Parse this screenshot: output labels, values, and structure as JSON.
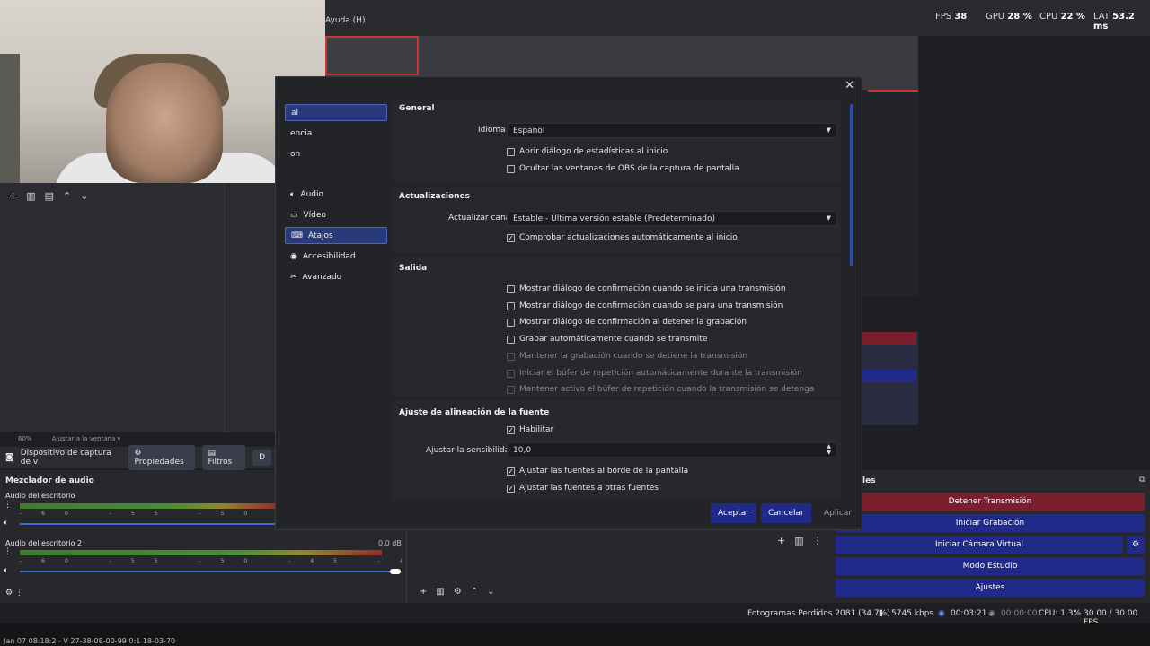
{
  "topbar": {
    "fps_label": "FPS",
    "fps": "38",
    "gpu_label": "GPU",
    "gpu": "28 %",
    "cpu_label": "CPU",
    "cpu": "22 %",
    "lat_label": "LAT",
    "lat": "53.2 ms"
  },
  "menu": {
    "help": "Ayuda (H)"
  },
  "preview": {
    "zoom": "60%",
    "fit": "Ajustar a la ventana"
  },
  "source_bar": {
    "source_name": "Dispositivo de captura de v",
    "properties": "Propiedades",
    "filters": "Filtros",
    "more": "D"
  },
  "mixer": {
    "title": "Mezclador de audio",
    "tracks": [
      {
        "name": "Audio del escritorio",
        "db": "",
        "level": 0.99,
        "volume": 1.0
      },
      {
        "name": "Audio del escritorio 2",
        "db": "0.0 dB",
        "level": 0.96,
        "volume": 1.0
      }
    ],
    "scale": [
      "-60",
      "-55",
      "-50",
      "-45",
      "-40",
      "-35",
      "-30",
      "-25",
      "-20",
      "-15",
      "-10",
      "-5",
      "0"
    ]
  },
  "controls": {
    "title": "les",
    "stop_stream": "Detener Transmisión",
    "start_record": "Iniciar Grabación",
    "start_vcam": "Iniciar Cámara Virtual",
    "studio_mode": "Modo Estudio",
    "settings": "Ajustes"
  },
  "status": {
    "dropped": "Fotogramas Perdidos 2081 (34.7%)",
    "bitrate": "5745 kbps",
    "stream_time": "00:03:21",
    "rec_time": "00:00:00",
    "cpu": "CPU: 1.3%",
    "fps": "30.00 / 30.00 FPS"
  },
  "bottom_strip": "Jan 07 08:18:2 - V 27-38-08-00-99 0:1 18-03-70",
  "dialog": {
    "nav": [
      {
        "label": "al",
        "icon": "",
        "selected": true
      },
      {
        "label": "encia",
        "icon": ""
      },
      {
        "label": "on",
        "icon": ""
      },
      {
        "label": "Audio",
        "icon": "speaker-icon"
      },
      {
        "label": "Vídeo",
        "icon": "monitor-icon"
      },
      {
        "label": "Atajos",
        "icon": "keyboard-icon",
        "hover": true
      },
      {
        "label": "Accesibilidad",
        "icon": "accessibility-icon"
      },
      {
        "label": "Avanzado",
        "icon": "tools-icon"
      }
    ],
    "general": {
      "title": "General",
      "language_label": "Idioma",
      "language_value": "Español",
      "stats_on_start": "Abrir diálogo de estadísticas al inicio",
      "hide_windows": "Ocultar las ventanas de OBS de la captura de pantalla"
    },
    "updates": {
      "title": "Actualizaciones",
      "channel_label": "Actualizar canal",
      "channel_value": "Estable - Última versión estable (Predeterminado)",
      "auto_check": "Comprobar actualizaciones automáticamente al inicio"
    },
    "output": {
      "title": "Salida",
      "items": [
        {
          "label": "Mostrar diálogo de confirmación cuando se inicia una transmisión",
          "checked": false,
          "enabled": true
        },
        {
          "label": "Mostrar diálogo de confirmación cuando se para una transmisión",
          "checked": false,
          "enabled": true
        },
        {
          "label": "Mostrar diálogo de confirmación al detener la grabación",
          "checked": false,
          "enabled": true
        },
        {
          "label": "Grabar automáticamente cuando se transmite",
          "checked": false,
          "enabled": true
        },
        {
          "label": "Mantener la grabación cuando se detiene la transmisión",
          "checked": false,
          "enabled": false
        },
        {
          "label": "Iniciar el búfer de repetición automáticamente durante la transmisión",
          "checked": false,
          "enabled": false
        },
        {
          "label": "Mantener activo el búfer de repetición cuando la transmisión se detenga",
          "checked": false,
          "enabled": false
        }
      ]
    },
    "snapping": {
      "title": "Ajuste de alineación de la fuente",
      "enable": "Habilitar",
      "sensitivity_label": "Ajustar la sensibilidad",
      "sensitivity_value": "10,0",
      "snap_screen": "Ajustar las fuentes al borde de la pantalla",
      "snap_sources": "Ajustar las fuentes a otras fuentes"
    },
    "buttons": {
      "accept": "Aceptar",
      "cancel": "Cancelar",
      "apply": "Aplicar"
    }
  },
  "colors": {
    "accent": "#283a7a",
    "stop": "#7a1f2e",
    "button": "#1f2a8a"
  }
}
